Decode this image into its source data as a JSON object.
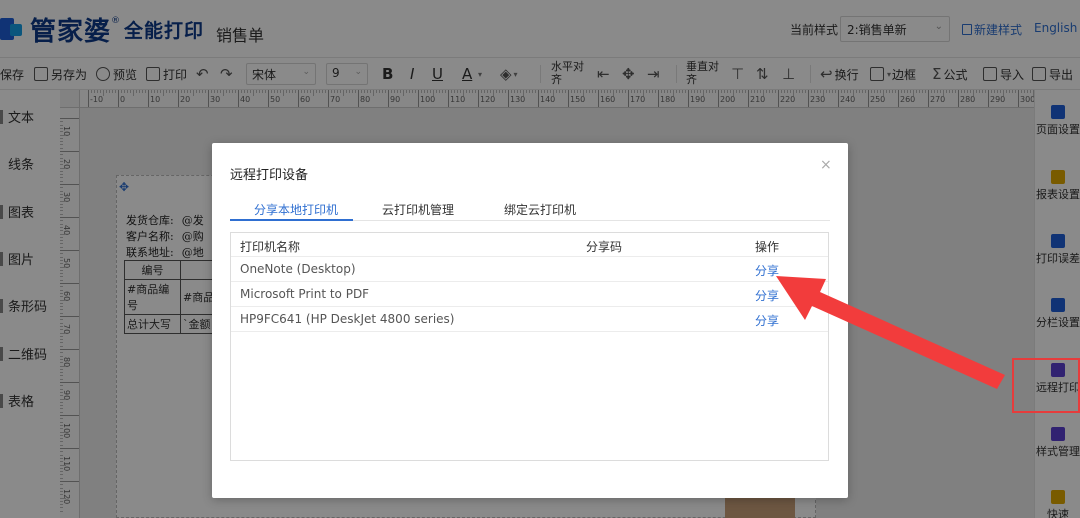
{
  "header": {
    "brand": "管家婆",
    "brand_mark": "®",
    "brand_sub": "全能打印",
    "doc_title": "销售单",
    "style_label": "当前样式",
    "style_value": "2:销售单新",
    "new_style": "新建样式",
    "language": "English"
  },
  "toolbar": {
    "save": "保存",
    "save_as": "另存为",
    "preview": "预览",
    "print": "打印",
    "font_family": "宋体",
    "font_size": "9",
    "bold": "B",
    "italic": "I",
    "underline": "U",
    "font_color": "A",
    "align_h": "水平对齐",
    "align_v": "垂直对齐",
    "wrap": "换行",
    "border": "边框",
    "formula": "公式",
    "import": "导入",
    "export": "导出"
  },
  "left_panel": {
    "items": [
      "文本",
      "线条",
      "图表",
      "图片",
      "条形码",
      "二维码",
      "表格"
    ]
  },
  "ruler": {
    "top_ticks": [
      "-10",
      "0",
      "10",
      "20",
      "30",
      "40",
      "50",
      "60",
      "70",
      "80",
      "90",
      "100",
      "110",
      "120",
      "130",
      "140",
      "150",
      "160",
      "170",
      "180",
      "190",
      "200",
      "210",
      "220",
      "230",
      "240",
      "250",
      "260",
      "270",
      "280",
      "290",
      "300",
      "310"
    ],
    "left_ticks": [
      "10",
      "20",
      "30",
      "40",
      "50",
      "60",
      "70",
      "80",
      "90",
      "100",
      "110",
      "120"
    ]
  },
  "paper": {
    "lines": [
      {
        "label": "发货仓库:",
        "value": "@发"
      },
      {
        "label": "客户名称:",
        "value": "@购"
      },
      {
        "label": "联系地址:",
        "value": "@地"
      }
    ],
    "table": [
      [
        "编号",
        ""
      ],
      [
        "#商品编号",
        "#商品"
      ],
      [
        "总计大写",
        "`金额"
      ]
    ]
  },
  "right_panel": {
    "items": [
      {
        "label": "页面设置",
        "color": "#1f5fd8"
      },
      {
        "label": "报表设置",
        "color": "#e0a800"
      },
      {
        "label": "打印误差",
        "color": "#1f5fd8"
      },
      {
        "label": "分栏设置",
        "color": "#1f5fd8"
      },
      {
        "label": "远程打印",
        "color": "#5b3fd1"
      },
      {
        "label": "样式管理",
        "color": "#5b3fd1"
      },
      {
        "label": "快速",
        "color": "#e0a800"
      }
    ]
  },
  "dialog": {
    "title": "远程打印设备",
    "close": "×",
    "tabs": [
      "分享本地打印机",
      "云打印机管理",
      "绑定云打印机"
    ],
    "columns": [
      "打印机名称",
      "分享码",
      "操作"
    ],
    "rows": [
      {
        "name": "OneNote (Desktop)",
        "code": "",
        "action": "分享"
      },
      {
        "name": "Microsoft Print to PDF",
        "code": "",
        "action": "分享"
      },
      {
        "name": "HP9FC641 (HP DeskJet 4800 series)",
        "code": "",
        "action": "分享"
      }
    ]
  },
  "colors": {
    "accent": "#2f6fd1",
    "annotation": "#e63c3c"
  }
}
